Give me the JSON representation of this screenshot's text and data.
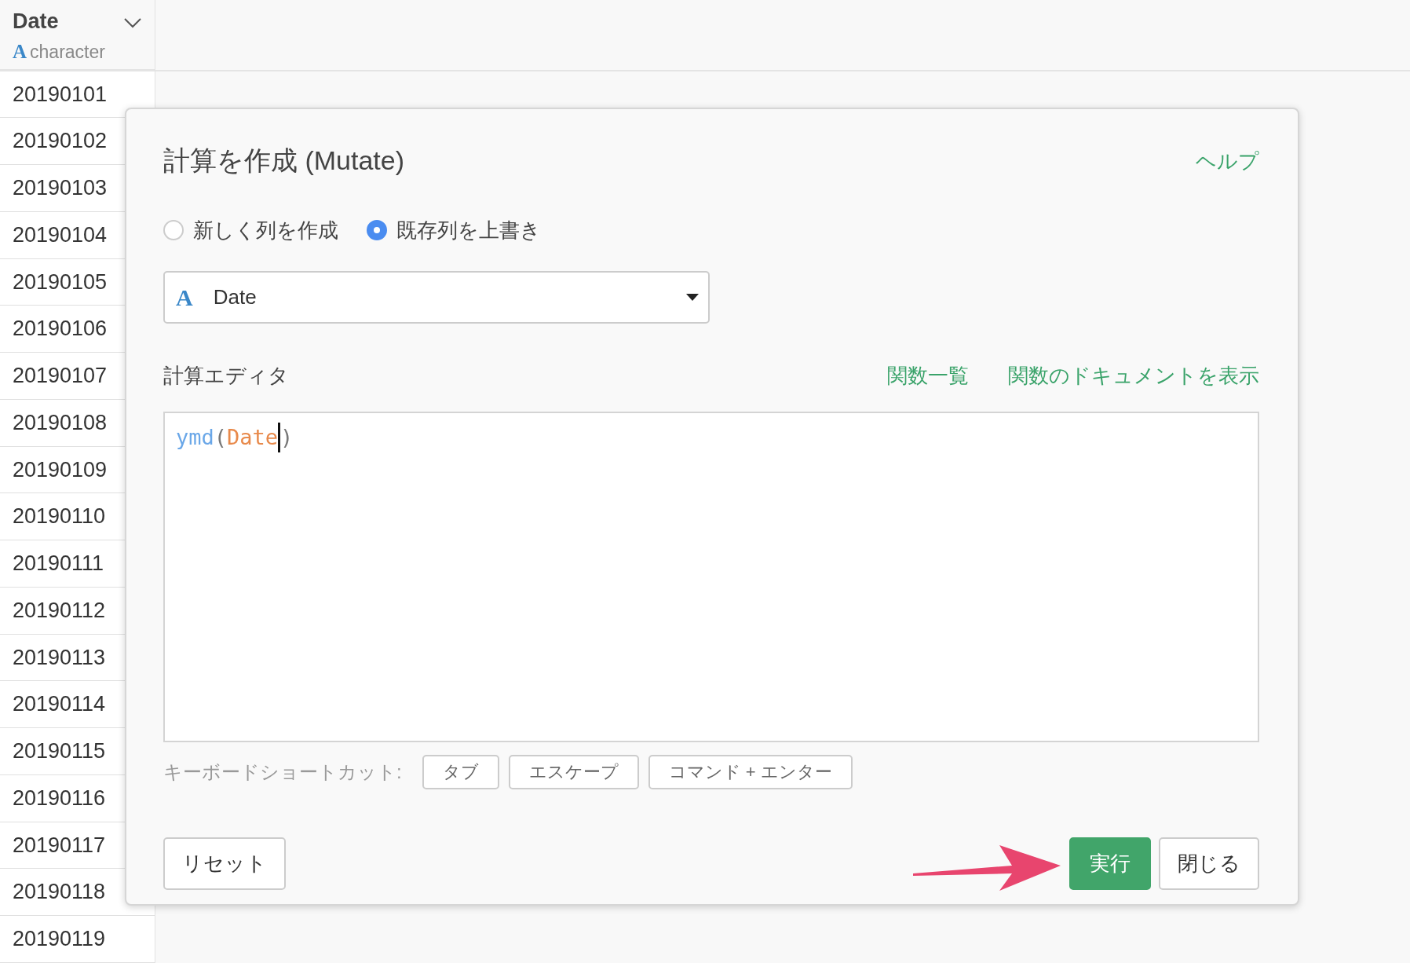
{
  "column": {
    "name": "Date",
    "type_icon": "A",
    "type_label": "character",
    "rows": [
      "20190101",
      "20190102",
      "20190103",
      "20190104",
      "20190105",
      "20190106",
      "20190107",
      "20190108",
      "20190109",
      "20190110",
      "20190111",
      "20190112",
      "20190113",
      "20190114",
      "20190115",
      "20190116",
      "20190117",
      "20190118",
      "20190119"
    ]
  },
  "dialog": {
    "title": "計算を作成 (Mutate)",
    "help": "ヘルプ",
    "modes": [
      {
        "label": "新しく列を作成",
        "selected": false
      },
      {
        "label": "既存列を上書き",
        "selected": true
      }
    ],
    "column_select": {
      "type_icon": "A",
      "value": "Date"
    },
    "editor": {
      "label": "計算エディタ",
      "links": [
        "関数一覧",
        "関数のドキュメントを表示"
      ],
      "code": [
        {
          "kind": "function",
          "text": "ymd"
        },
        {
          "kind": "paren",
          "text": "("
        },
        {
          "kind": "argument",
          "text": "Date"
        },
        {
          "kind": "cursor"
        },
        {
          "kind": "paren",
          "text": ")"
        }
      ]
    },
    "shortcuts": {
      "label": "キーボードショートカット:",
      "keys": [
        "タブ",
        "エスケープ",
        "コマンド + エンター"
      ]
    },
    "reset_button": {
      "label": "リセット"
    },
    "actions": [
      {
        "label": "実行",
        "kind": "primary"
      },
      {
        "label": "閉じる",
        "kind": "secondary"
      }
    ]
  },
  "annotation_arrow": true
}
